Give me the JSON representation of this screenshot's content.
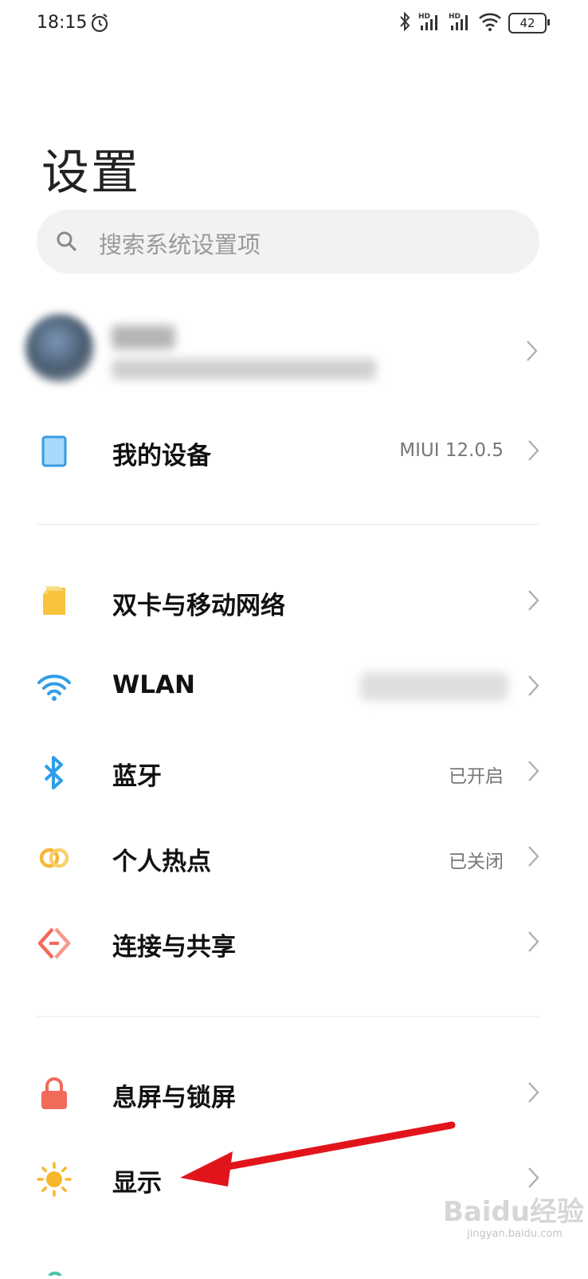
{
  "status_bar": {
    "time": "18:15",
    "battery": "42",
    "icons": [
      "alarm-icon",
      "bluetooth-icon",
      "hd-signal-icon",
      "hd-signal-icon",
      "wifi-icon",
      "battery-icon"
    ]
  },
  "page": {
    "title": "设置"
  },
  "search": {
    "placeholder": "搜索系统设置项",
    "icon": "search-icon"
  },
  "account": {
    "name": "",
    "subtitle": ""
  },
  "sections": {
    "device": {
      "label": "我的设备",
      "value": "MIUI 12.0.5",
      "icon": "phone-device-icon",
      "color": "#5ab4f5"
    },
    "sim": {
      "label": "双卡与移动网络",
      "icon": "sim-card-icon",
      "color": "#f9c33b"
    },
    "wlan": {
      "label": "WLAN",
      "value": "",
      "icon": "wifi-icon",
      "color": "#2f9ee8"
    },
    "bluetooth": {
      "label": "蓝牙",
      "value": "已开启",
      "icon": "bluetooth-icon",
      "color": "#2f9ee8"
    },
    "hotspot": {
      "label": "个人热点",
      "value": "已关闭",
      "icon": "hotspot-icon",
      "color": "#f5b733"
    },
    "connect": {
      "label": "连接与共享",
      "icon": "connect-share-icon",
      "color": "#f26a5a"
    },
    "lock": {
      "label": "息屏与锁屏",
      "icon": "lock-icon",
      "color": "#f26a5a"
    },
    "display": {
      "label": "显示",
      "icon": "sun-icon",
      "color": "#f9b72d"
    }
  },
  "annotation": {
    "arrow_color": "#e2141b"
  },
  "watermark": {
    "text": "Baidu经验",
    "sub": "jingyan.baidu.com"
  }
}
